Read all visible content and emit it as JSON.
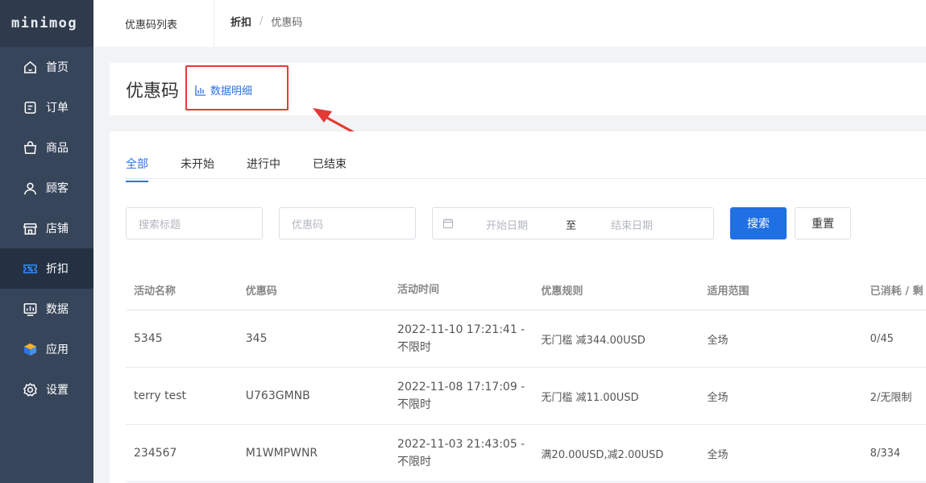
{
  "app": {
    "logo": "minimog"
  },
  "sidebar": {
    "items": [
      {
        "label": "首页",
        "icon": "home-icon"
      },
      {
        "label": "订单",
        "icon": "order-icon"
      },
      {
        "label": "商品",
        "icon": "bag-icon"
      },
      {
        "label": "顾客",
        "icon": "user-icon"
      },
      {
        "label": "店铺",
        "icon": "store-icon"
      },
      {
        "label": "折扣",
        "icon": "discount-icon",
        "active": true
      },
      {
        "label": "数据",
        "icon": "chart-icon"
      },
      {
        "label": "应用",
        "icon": "cube-icon"
      },
      {
        "label": "设置",
        "icon": "gear-icon"
      }
    ]
  },
  "topbar": {
    "tab": "优惠码列表",
    "breadcrumb": {
      "parent": "折扣",
      "separator": "/",
      "current": "优惠码"
    }
  },
  "header": {
    "title": "优惠码",
    "data_link": "数据明细"
  },
  "tabs": [
    {
      "label": "全部",
      "active": true
    },
    {
      "label": "未开始"
    },
    {
      "label": "进行中"
    },
    {
      "label": "已结束"
    }
  ],
  "filters": {
    "title_placeholder": "搜索标题",
    "code_placeholder": "优惠码",
    "start_date_placeholder": "开始日期",
    "range_separator": "至",
    "end_date_placeholder": "结束日期",
    "search_label": "搜索",
    "reset_label": "重置"
  },
  "table": {
    "headers": [
      "活动名称",
      "优惠码",
      "活动时间",
      "优惠规则",
      "适用范围",
      "已消耗 / 剩"
    ],
    "rows": [
      {
        "name": "5345",
        "code": "345",
        "time_start": "2022-11-10 17:21:41 -",
        "time_end": "不限时",
        "rule": "无门槛 减344.00USD",
        "scope": "全场",
        "usage": "0/45"
      },
      {
        "name": "terry test",
        "code": "U763GMNB",
        "time_start": "2022-11-08 17:17:09 -",
        "time_end": "不限时",
        "rule": "无门槛 减11.00USD",
        "scope": "全场",
        "usage": "2/无限制"
      },
      {
        "name": "234567",
        "code": "M1WMPWNR",
        "time_start": "2022-11-03 21:43:05 -",
        "time_end": "不限时",
        "rule": "满20.00USD,减2.00USD",
        "scope": "全场",
        "usage": "8/334"
      }
    ]
  },
  "colors": {
    "accent": "#1f6fe5",
    "sidebar": "#37455a",
    "sidebar_active": "#243142",
    "annotation": "#e53935"
  }
}
